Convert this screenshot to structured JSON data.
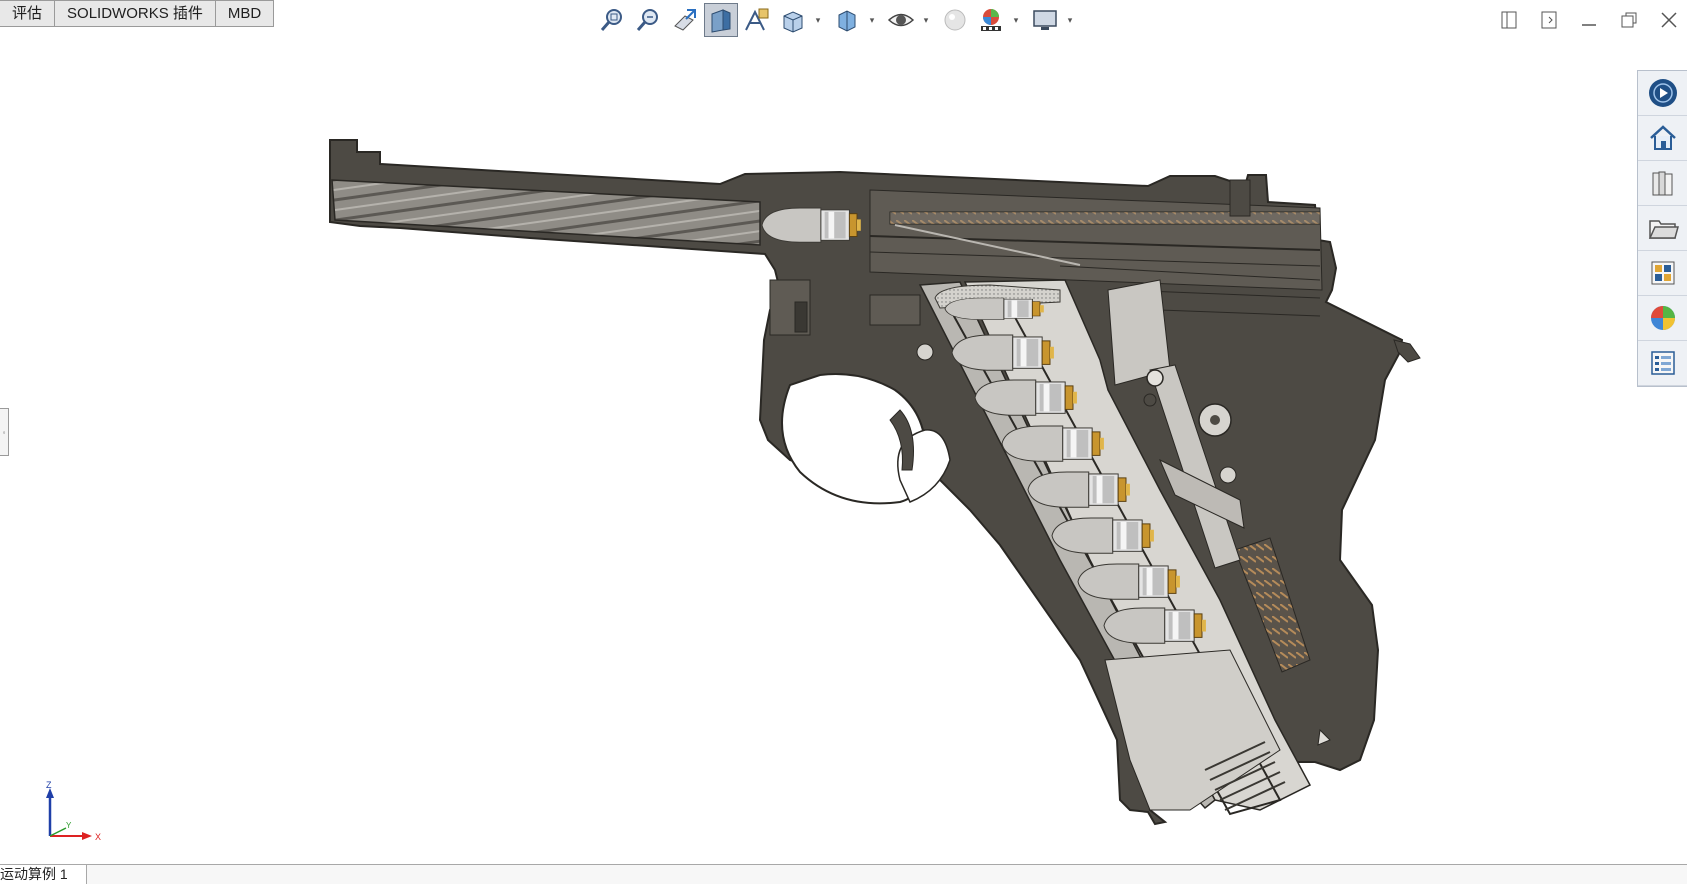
{
  "command_tabs": [
    {
      "label": "评估"
    },
    {
      "label": "SOLIDWORKS 插件"
    },
    {
      "label": "MBD"
    }
  ],
  "hud_icons": [
    "zoom-to-fit-icon",
    "zoom-to-area-icon",
    "previous-view-icon",
    "section-view-icon",
    "dynamic-annotation-view-icon",
    "view-orientation-icon",
    "display-style-icon",
    "hide-show-items-icon",
    "edit-appearance-icon",
    "apply-scene-icon",
    "view-settings-icon"
  ],
  "window_controls": [
    "tile-left-icon",
    "tile-right-icon",
    "minimize-icon",
    "restore-icon",
    "close-icon"
  ],
  "task_pane": [
    "solidworks-resources-icon",
    "home-icon",
    "design-library-icon",
    "file-explorer-icon",
    "view-palette-icon",
    "appearances-icon",
    "custom-properties-icon"
  ],
  "triad": {
    "z": "Z",
    "y": "Y",
    "x": "X"
  },
  "bottom_tab": {
    "label": "运动算例 1"
  },
  "colors": {
    "metal_dark": "#4d4a44",
    "metal_light": "#c6c4c0",
    "brass": "#c8952e",
    "accent_blue": "#1e5aa8"
  }
}
